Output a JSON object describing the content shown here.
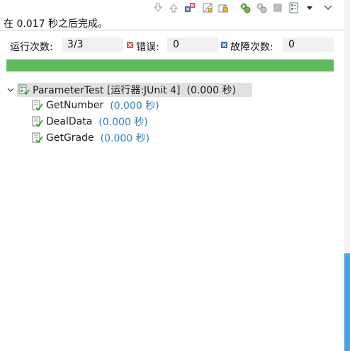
{
  "status_text": "在 0.017 秒之后完成。",
  "counters": {
    "runs_label": "运行次数:",
    "runs_value": "3/3",
    "errors_label": "错误:",
    "errors_value": "0",
    "failures_label": "故障次数:",
    "failures_value": "0"
  },
  "progress": {
    "fraction": 1.0,
    "color": "#5dbb5b"
  },
  "tree": {
    "root": {
      "label": "ParameterTest [运行器:JUnit 4]",
      "time": "(0.000 秒)"
    },
    "children": [
      {
        "label": "GetNumber",
        "time": "(0.000 秒)"
      },
      {
        "label": "DealData",
        "time": "(0.000 秒)"
      },
      {
        "label": "GetGrade",
        "time": "(0.000 秒)"
      }
    ]
  },
  "toolbar_icons": [
    "next-failure-icon",
    "previous-failure-icon",
    "show-failures-only-icon",
    "scroll-lock-icon",
    "history-lock-icon",
    "rerun-icon",
    "rerun-failed-first-icon",
    "stop-icon",
    "history-icon",
    "history-dropdown-icon",
    "view-menu-icon"
  ],
  "colors": {
    "time_text": "#2c7fba",
    "progress_green": "#5dbb5b",
    "error_red": "#d9534f",
    "failure_blue": "#3a6ea5"
  }
}
